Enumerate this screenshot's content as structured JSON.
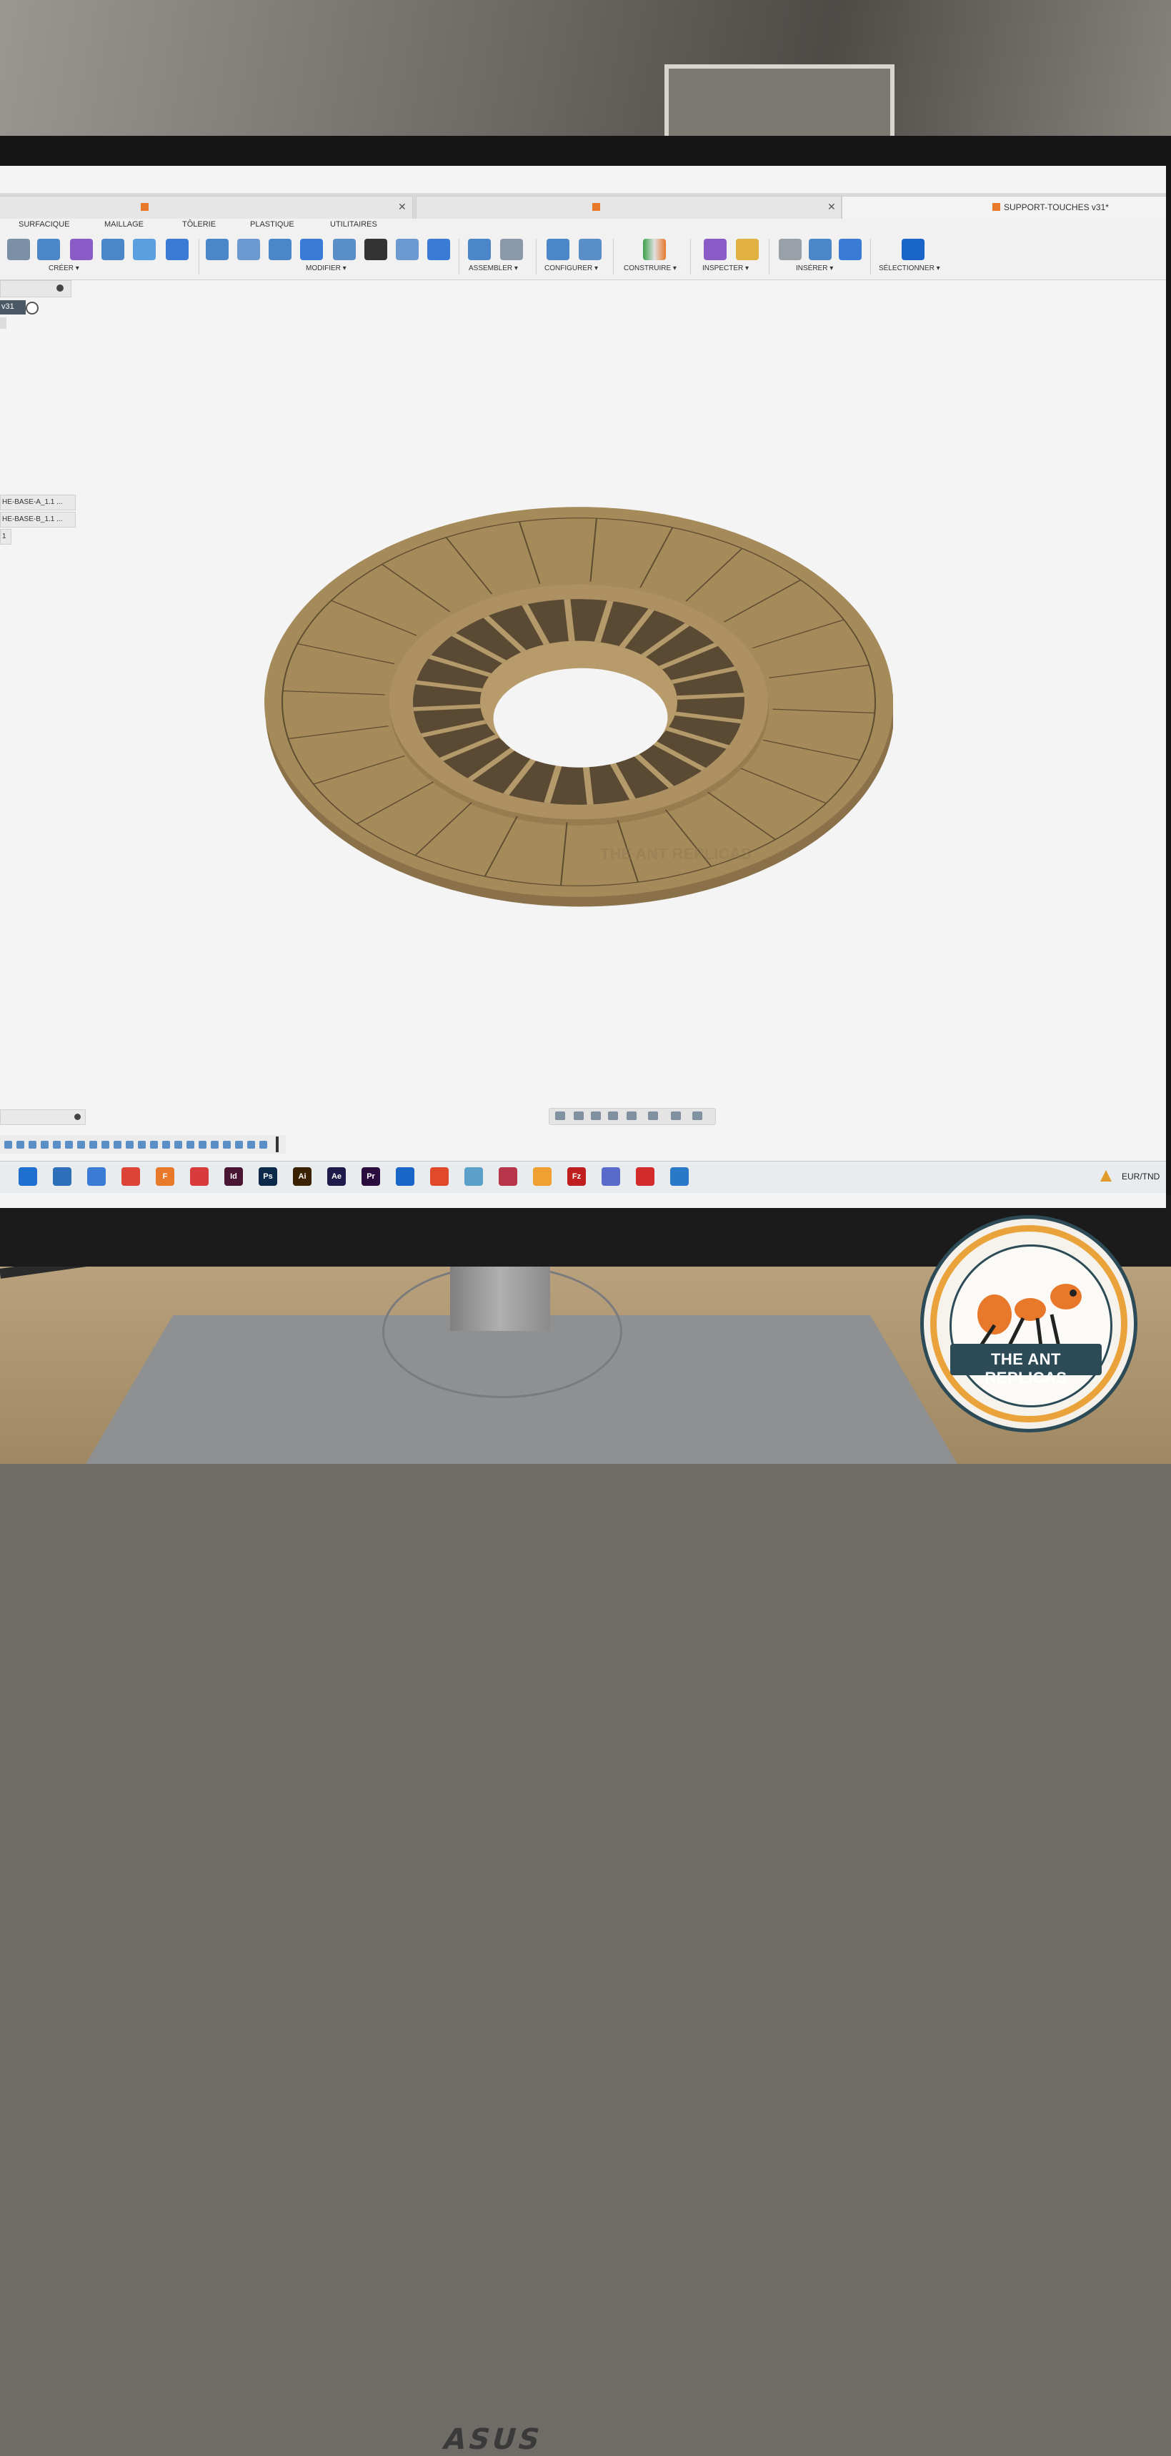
{
  "window": {
    "tabs": [
      {
        "title": "",
        "active": false
      },
      {
        "title": "",
        "active": false
      },
      {
        "title": "SUPPORT-TOUCHES v31*",
        "active": true
      }
    ]
  },
  "ribbon": {
    "tabs": [
      "SURFACIQUE",
      "MAILLAGE",
      "TÔLERIE",
      "PLASTIQUE",
      "UTILITAIRES"
    ],
    "groups": [
      "CRÉER ▾",
      "MODIFIER ▾",
      "ASSEMBLER ▾",
      "CONFIGURER ▾",
      "CONSTRUIRE ▾",
      "INSPECTER ▾",
      "INSÉRER ▾",
      "SÉLECTIONNER ▾"
    ]
  },
  "browser": {
    "root_label": "v31",
    "components": [
      "HE-BASE-A_1.1 ...",
      "HE-BASE-B_1.1 ...",
      "1"
    ]
  },
  "viewport": {
    "model": "ring-with-ribs",
    "body_color": "#a58a5a",
    "watermark": "THE ANT REPLICAS"
  },
  "taskbar": {
    "apps": [
      {
        "icon": "file-explorer-icon",
        "label": "",
        "color": "#1f6fd1"
      },
      {
        "icon": "mail-icon",
        "label": "",
        "color": "#2d6fb8"
      },
      {
        "icon": "app-icon",
        "label": "",
        "color": "#3a7bd5"
      },
      {
        "icon": "chrome-icon",
        "label": "",
        "color": "#db4437"
      },
      {
        "icon": "fusion-icon",
        "label": "F",
        "color": "#e8792b"
      },
      {
        "icon": "sketchup-icon",
        "label": "",
        "color": "#d83b3b"
      },
      {
        "icon": "indesign-icon",
        "label": "Id",
        "color": "#4a1433"
      },
      {
        "icon": "photoshop-icon",
        "label": "Ps",
        "color": "#0b2a4a"
      },
      {
        "icon": "illustrator-icon",
        "label": "Ai",
        "color": "#3a2200"
      },
      {
        "icon": "after-effects-icon",
        "label": "Ae",
        "color": "#1e1b4b"
      },
      {
        "icon": "premiere-icon",
        "label": "Pr",
        "color": "#2a0c3f"
      },
      {
        "icon": "app-icon",
        "label": "",
        "color": "#1a66c8"
      },
      {
        "icon": "app-icon",
        "label": "",
        "color": "#e04a2a"
      },
      {
        "icon": "app-icon",
        "label": "",
        "color": "#5aa0c8"
      },
      {
        "icon": "app-icon",
        "label": "",
        "color": "#b8364a"
      },
      {
        "icon": "app-icon",
        "label": "",
        "color": "#f0a030"
      },
      {
        "icon": "filezilla-icon",
        "label": "Fz",
        "color": "#bf1f1f"
      },
      {
        "icon": "app-icon",
        "label": "",
        "color": "#5a6acb"
      },
      {
        "icon": "acrobat-icon",
        "label": "",
        "color": "#d32a2a"
      },
      {
        "icon": "app-icon",
        "label": "",
        "color": "#2a78c8"
      }
    ],
    "tray_text": "EUR/TND"
  },
  "monitor": {
    "brand": "ASUS"
  },
  "logo": {
    "text": "THE ANT REPLICAS"
  }
}
